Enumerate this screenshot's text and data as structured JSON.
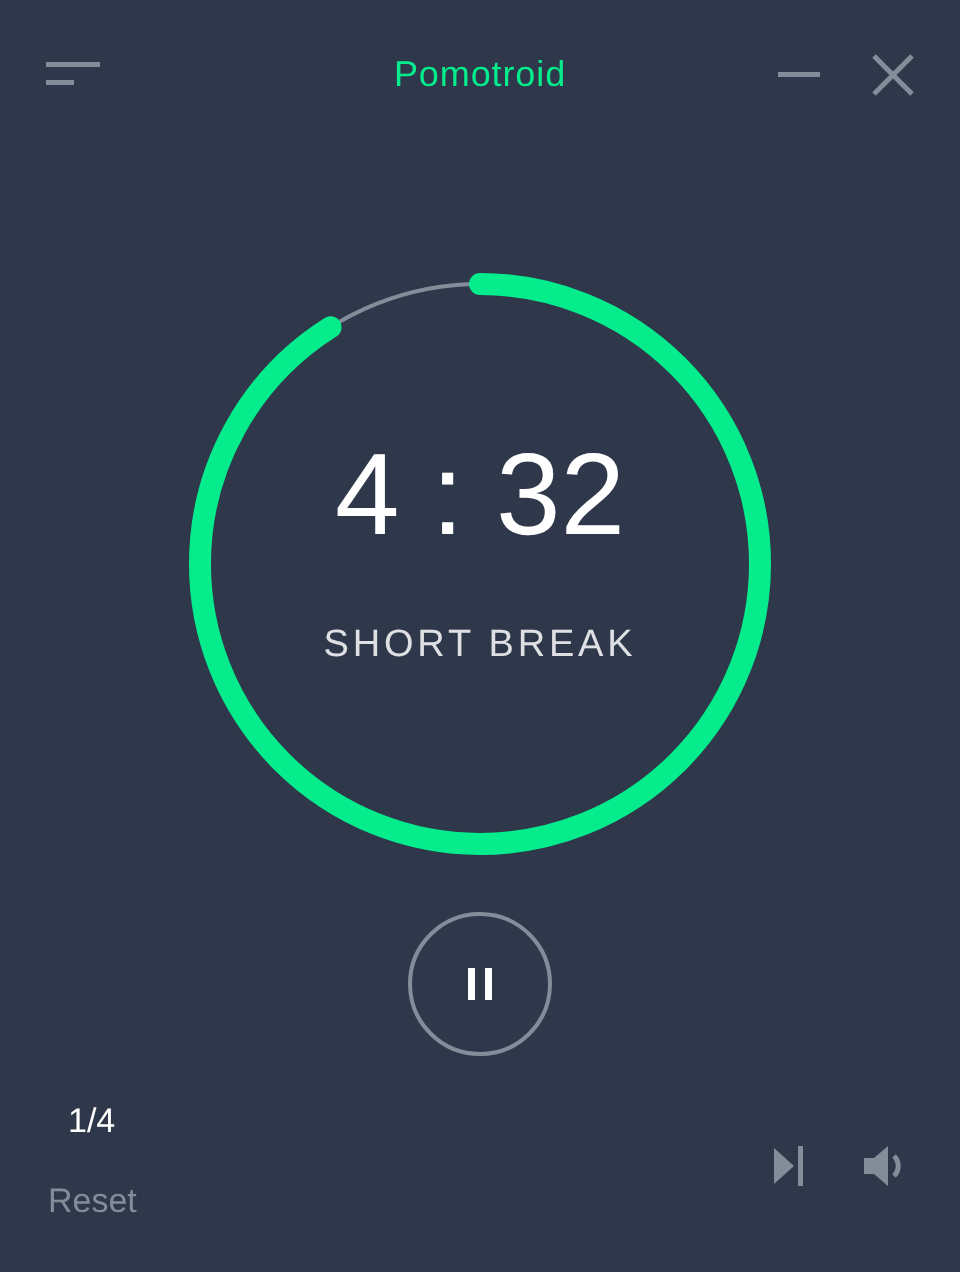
{
  "window": {
    "title": "Pomotroid"
  },
  "timer": {
    "time": "4 : 32",
    "label": "SHORT BREAK",
    "running": true
  },
  "round": {
    "count": "1/4",
    "reset": "Reset"
  }
}
